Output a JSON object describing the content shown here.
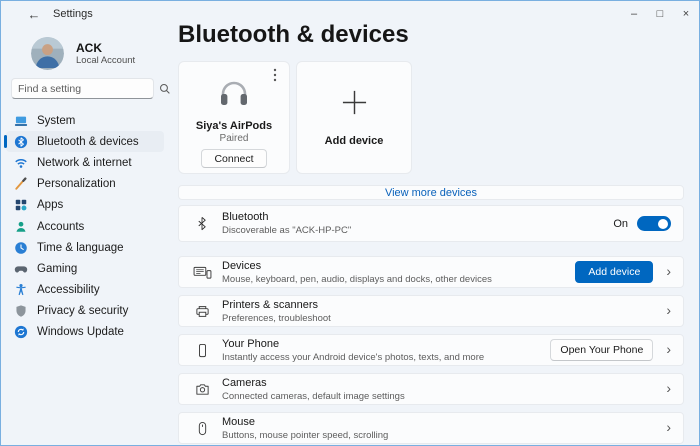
{
  "titlebar": {
    "title": "Settings",
    "back_glyph": "←",
    "minimize_glyph": "–",
    "maximize_glyph": "□",
    "close_glyph": "×"
  },
  "sidebar": {
    "account": {
      "name": "ACK",
      "type": "Local Account"
    },
    "search": {
      "placeholder": "Find a setting"
    },
    "items": [
      {
        "label": "System",
        "icon": "system-icon",
        "selected": false
      },
      {
        "label": "Bluetooth & devices",
        "icon": "bluetooth-icon",
        "selected": true
      },
      {
        "label": "Network & internet",
        "icon": "network-icon",
        "selected": false
      },
      {
        "label": "Personalization",
        "icon": "personalization-icon",
        "selected": false
      },
      {
        "label": "Apps",
        "icon": "apps-icon",
        "selected": false
      },
      {
        "label": "Accounts",
        "icon": "accounts-icon",
        "selected": false
      },
      {
        "label": "Time & language",
        "icon": "time-language-icon",
        "selected": false
      },
      {
        "label": "Gaming",
        "icon": "gaming-icon",
        "selected": false
      },
      {
        "label": "Accessibility",
        "icon": "accessibility-icon",
        "selected": false
      },
      {
        "label": "Privacy & security",
        "icon": "privacy-icon",
        "selected": false
      },
      {
        "label": "Windows Update",
        "icon": "windows-update-icon",
        "selected": false
      }
    ]
  },
  "main": {
    "title": "Bluetooth & devices",
    "device_card": {
      "name": "Siya's AirPods",
      "status": "Paired",
      "connect_label": "Connect",
      "menu_icon": "more-options-icon",
      "device_icon": "headphones-icon"
    },
    "add_device_card": {
      "label": "Add device",
      "icon": "plus-icon"
    },
    "view_more_label": "View more devices",
    "rows": [
      {
        "title": "Bluetooth",
        "subtitle": "Discoverable as \"ACK-HP-PC\"",
        "toggle_label": "On",
        "toggle_state": "on",
        "icon": "bluetooth-glyph-icon"
      },
      {
        "title": "Devices",
        "subtitle": "Mouse, keyboard, pen, audio, displays and docks, other devices",
        "button": "Add device",
        "icon": "devices-icon"
      },
      {
        "title": "Printers & scanners",
        "subtitle": "Preferences, troubleshoot",
        "icon": "printer-icon"
      },
      {
        "title": "Your Phone",
        "subtitle": "Instantly access your Android device's photos, texts, and more",
        "button": "Open Your Phone",
        "icon": "phone-icon"
      },
      {
        "title": "Cameras",
        "subtitle": "Connected cameras, default image settings",
        "icon": "camera-icon"
      },
      {
        "title": "Mouse",
        "subtitle": "Buttons, mouse pointer speed, scrolling",
        "icon": "mouse-icon"
      }
    ],
    "chevron_glyph": "›"
  },
  "colors": {
    "accent": "#0067c0",
    "link": "#0a62bb",
    "window_background": "#f0f4f9",
    "surface": "#fbfcfd",
    "window_border": "#79afe0"
  }
}
